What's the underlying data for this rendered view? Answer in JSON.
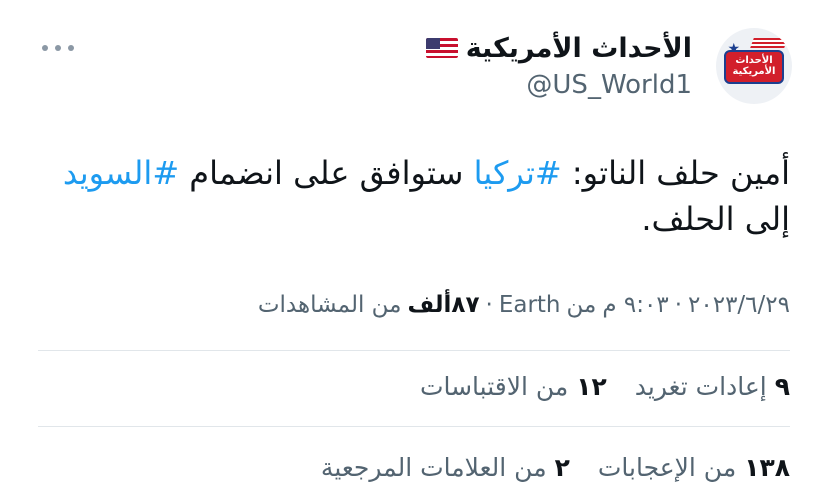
{
  "account": {
    "display_name": "الأحداث الأمريكية",
    "handle": "@US_World1",
    "flag_icon": "us-flag-icon",
    "avatar_text": "الأحداث الأمريكية"
  },
  "tweet": {
    "text_parts": [
      "أمين حلف الناتو: ",
      "#تركيا",
      " ستوافق على انضمام ",
      "#السويد",
      " إلى الحلف."
    ],
    "hashtag_color": "#1d9bf0"
  },
  "meta": {
    "date": "٢٠٢٣/٦/٢٩",
    "time": "٩:٠٣ م",
    "source_prefix": "من",
    "source": "Earth",
    "views_count": "٨٧ألف",
    "views_label": "من المشاهدات"
  },
  "stats": {
    "retweets_count": "٩",
    "retweets_label": "إعادات تغريد",
    "quotes_count": "١٢",
    "quotes_label": "من الاقتباسات",
    "likes_count": "١٣٨",
    "likes_label": "من الإعجابات",
    "bookmarks_count": "٢",
    "bookmarks_label": "من العلامات المرجعية"
  },
  "colors": {
    "text": "#0f1419",
    "muted": "#536471",
    "accent": "#1d9bf0"
  }
}
